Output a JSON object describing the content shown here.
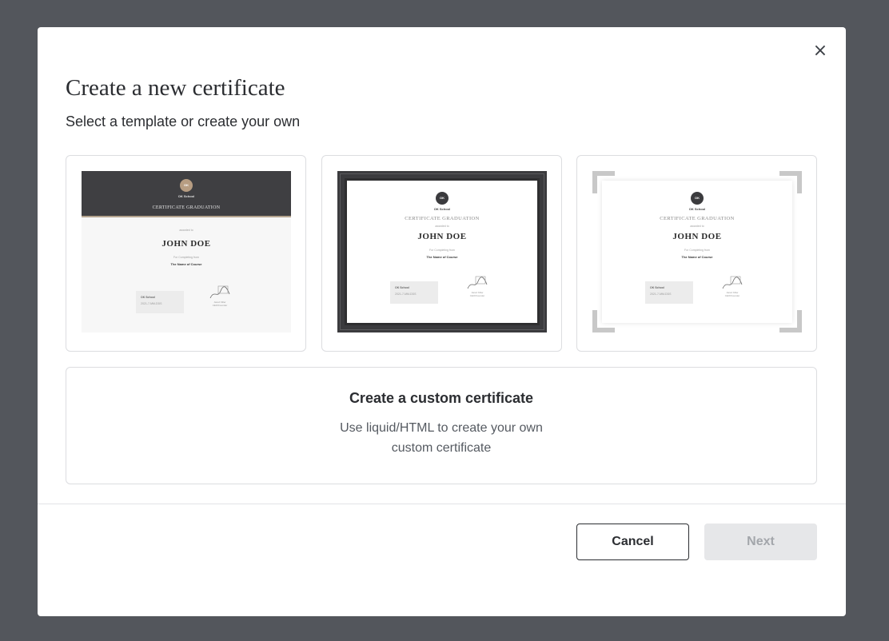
{
  "dialog": {
    "title": "Create a new certificate",
    "subtitle": "Select a template or create your own",
    "close_icon": "×"
  },
  "templates": [
    {
      "school": "OK School",
      "logo_text": "OK",
      "certificate_title": "CERTIFICATE GRADUATION",
      "awarded_to": "awarded to",
      "recipient": "JOHN DOE",
      "for_completing": "For Completing from",
      "course": "The Name of Course",
      "signer_school": "OK School",
      "signer_date": "2021-7-MM-DDS",
      "signature_caption_1": "Jared Killer",
      "signature_caption_2": "CEO/Founder"
    },
    {
      "school": "OK School",
      "logo_text": "OK",
      "certificate_title": "CERTIFICATE GRADUATION",
      "awarded_to": "awarded to",
      "recipient": "JOHN DOE",
      "for_completing": "For Completing from",
      "course": "The Name of Course",
      "signer_school": "OK School",
      "signer_date": "2021-7-MM-DDS",
      "signature_caption_1": "Jared Killer",
      "signature_caption_2": "CEO/Founder"
    },
    {
      "school": "OK School",
      "logo_text": "OK",
      "certificate_title": "CERTIFICATE GRADUATION",
      "awarded_to": "awarded to",
      "recipient": "JOHN DOE",
      "for_completing": "For Completing from",
      "course": "The Name of Course",
      "signer_school": "OK School",
      "signer_date": "2021-7-MM-DDS",
      "signature_caption_1": "Jared Killer",
      "signature_caption_2": "CEO/Founder"
    }
  ],
  "custom": {
    "title": "Create a custom certificate",
    "description": "Use liquid/HTML to create your own custom certificate"
  },
  "footer": {
    "cancel_label": "Cancel",
    "next_label": "Next"
  },
  "colors": {
    "overlay": "#53565c",
    "template1_band": "#3f3f42",
    "template1_logo": "#b79d82",
    "template2_frame": "#3b3b3e",
    "next_disabled_bg": "#e6e7e9"
  }
}
